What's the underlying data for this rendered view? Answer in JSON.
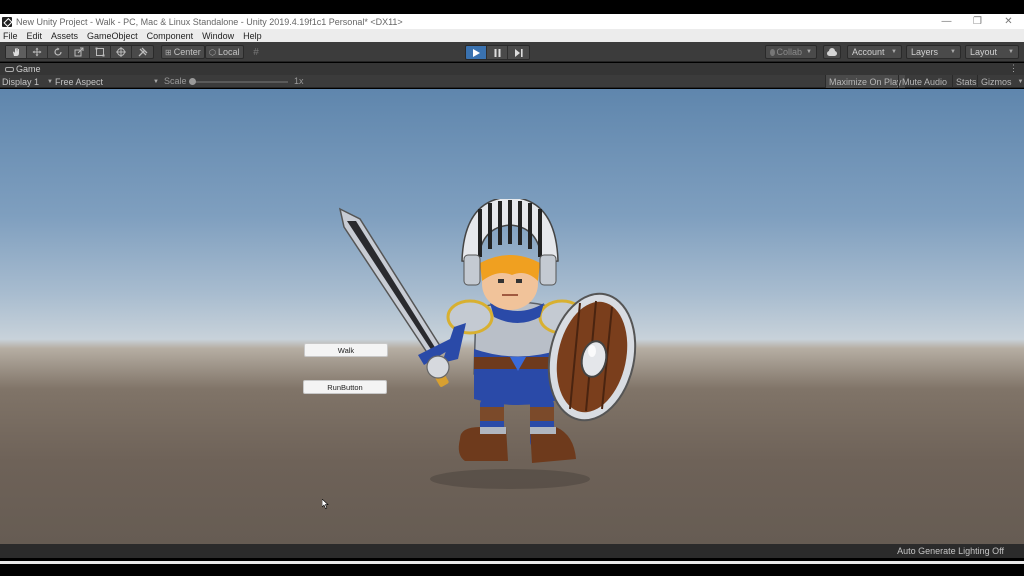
{
  "window": {
    "title": "New Unity Project - Walk - PC, Mac & Linux Standalone - Unity 2019.4.19f1c1 Personal* <DX11>",
    "minimize": "—",
    "maximize": "❐",
    "close": "✕"
  },
  "menubar": {
    "items": [
      "File",
      "Edit",
      "Assets",
      "GameObject",
      "Component",
      "Window",
      "Help"
    ]
  },
  "toolbar": {
    "tools": [
      "hand-icon",
      "move-icon",
      "rotate-icon",
      "scale-icon",
      "rect-icon",
      "transform-icon",
      "custom-tool-icon"
    ],
    "pivot_label": "Center",
    "rotation_label": "Local",
    "collab_label": "Collab",
    "account_label": "Account",
    "layers_label": "Layers",
    "layout_label": "Layout",
    "play_state": "playing"
  },
  "game_tab": {
    "label": "Game"
  },
  "game_controls": {
    "display": "Display 1",
    "aspect": "Free Aspect",
    "scale_label": "Scale",
    "scale_value": "1x",
    "maximize_on_play": "Maximize On Play",
    "mute_audio": "Mute Audio",
    "stats": "Stats",
    "gizmos": "Gizmos"
  },
  "game_view": {
    "buttons": [
      {
        "label": "Walk"
      },
      {
        "label": "RunButton"
      }
    ]
  },
  "status": {
    "text": "Auto Generate Lighting Off"
  },
  "colors": {
    "play_active": "#3a72b0",
    "toolbar_bg": "#3c3c3c",
    "sky_top": "#5f86ad",
    "ground": "#6e6258"
  }
}
